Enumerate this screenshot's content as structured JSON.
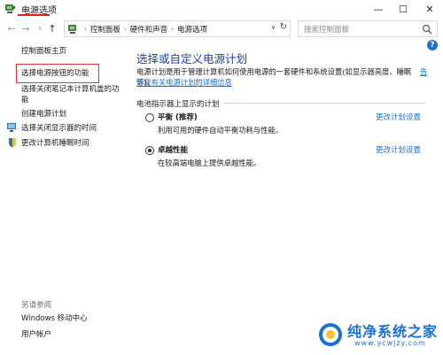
{
  "window": {
    "title": "电源选项",
    "minimize": "—",
    "maximize": "☐",
    "close": "✕"
  },
  "nav": {
    "back": "←",
    "forward": "→",
    "dropdown": "∨",
    "up": "↑"
  },
  "address": {
    "breadcrumbs": [
      "控制面板",
      "硬件和声音",
      "电源选项"
    ],
    "separator": "›",
    "dropdown": "∨",
    "refresh": "↻"
  },
  "search": {
    "placeholder": "搜索控制面板"
  },
  "help": "?",
  "sidebar": {
    "home": "控制面板主页",
    "items": [
      {
        "label": "选择电源按钮的功能"
      },
      {
        "label": "选择关闭笔记本计算机盖的功",
        "label2": "能"
      },
      {
        "label": "创建电源计划"
      },
      {
        "label": "选择关闭显示器的时间"
      },
      {
        "label": "更改计算机睡眠时间"
      }
    ],
    "see_also_title": "另请参阅",
    "see_also": [
      "Windows 移动中心",
      "用户帐户"
    ]
  },
  "main": {
    "title": "选择或自定义电源计划",
    "description": "电源计划是用于管理计算机如何使用电源的一套硬件和系统设置(如显示器亮度、睡眠等)。",
    "description_more": "告",
    "description_link": "诉我有关电源计划的详细信息",
    "section_label": "电池指示器上显示的计划",
    "plans": [
      {
        "name": "平衡 (推荐)",
        "desc": "利用可用的硬件自动平衡功耗与性能。",
        "link": "更改计划设置",
        "selected": false
      },
      {
        "name": "卓越性能",
        "desc": "在较高端电脑上提供卓越性能。",
        "link": "更改计划设置",
        "selected": true
      }
    ]
  },
  "watermark": {
    "text": "纯净系统之家",
    "url": "www.ycwjzy.com"
  },
  "colors": {
    "accent_link": "#1a6fcf",
    "title_blue": "#1f3f99",
    "highlight_red": "#e53030"
  }
}
